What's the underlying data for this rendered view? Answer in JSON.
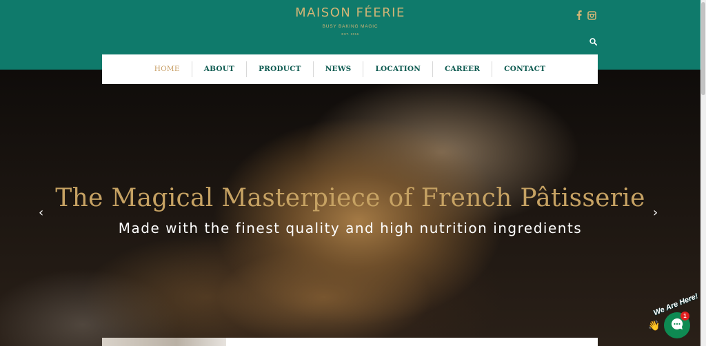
{
  "brand": {
    "name": "MAISON FÉERIE",
    "tagline": "BUSY BAKING MAGIC",
    "established": "EST. 2016",
    "header_color": "#0f7a6b",
    "gold": "#d2b576"
  },
  "header_icons": [
    "facebook-icon",
    "instagram-icon",
    "search-icon"
  ],
  "nav": {
    "items": [
      {
        "label": "HOME",
        "active": true
      },
      {
        "label": "ABOUT",
        "active": false
      },
      {
        "label": "PRODUCT",
        "active": false
      },
      {
        "label": "NEWS",
        "active": false
      },
      {
        "label": "LOCATION",
        "active": false
      },
      {
        "label": "CAREER",
        "active": false
      },
      {
        "label": "CONTACT",
        "active": false
      }
    ]
  },
  "hero": {
    "title": "The Magical Masterpiece of French Pâtisserie",
    "subtitle": "Made with the finest quality and high nutrition ingredients",
    "prev_arrow": "‹",
    "next_arrow": "›"
  },
  "chat": {
    "label": "We Are Here!",
    "wave": "👋",
    "badge_count": "1",
    "color": "#0e8a52"
  }
}
